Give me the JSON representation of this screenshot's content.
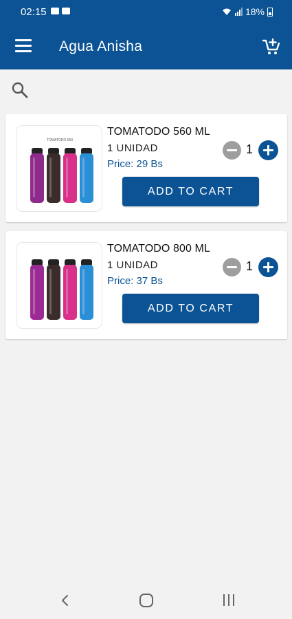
{
  "status_bar": {
    "time": "02:15",
    "battery": "18%"
  },
  "app_bar": {
    "title": "Agua Anisha",
    "menu_icon": "menu-icon",
    "cart_icon": "add-shopping-cart-icon"
  },
  "search": {
    "icon": "search-icon"
  },
  "products": [
    {
      "name": "TOMATODO 560 ML",
      "unit": "1  UNIDAD",
      "price": "Price: 29 Bs",
      "quantity": "1",
      "button_label": "ADD TO CART",
      "bottle_colors": [
        "#8e2a8c",
        "#3a2c2a",
        "#d8318a",
        "#2b8fd6"
      ]
    },
    {
      "name": "TOMATODO 800 ML",
      "unit": "1  UNIDAD",
      "price": "Price: 37 Bs",
      "quantity": "1",
      "button_label": "ADD TO CART",
      "bottle_colors": [
        "#9b2a94",
        "#3a2c2a",
        "#d8318a",
        "#2b8fd6"
      ]
    }
  ],
  "colors": {
    "primary": "#0b5394",
    "background": "#f2f2f2",
    "minus_button": "#9e9e9e"
  }
}
